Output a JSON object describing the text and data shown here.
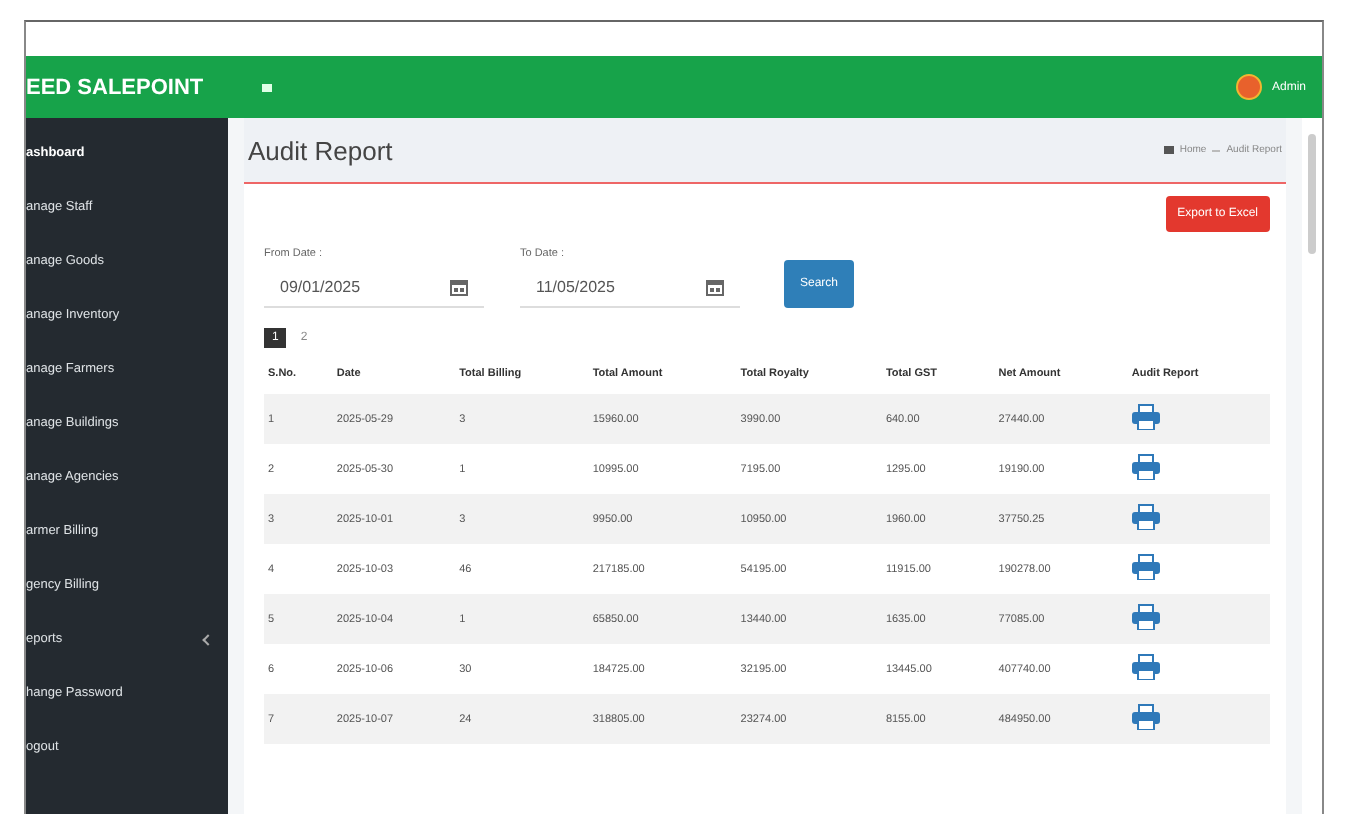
{
  "brand": "EED SALEPOINT",
  "user": {
    "name": "Admin"
  },
  "sidebar": {
    "items": [
      {
        "label": "ashboard",
        "selected": true,
        "has_submenu": false
      },
      {
        "label": "anage Staff",
        "selected": false,
        "has_submenu": false
      },
      {
        "label": "anage Goods",
        "selected": false,
        "has_submenu": false
      },
      {
        "label": "anage Inventory",
        "selected": false,
        "has_submenu": false
      },
      {
        "label": "anage Farmers",
        "selected": false,
        "has_submenu": false
      },
      {
        "label": "anage Buildings",
        "selected": false,
        "has_submenu": false
      },
      {
        "label": "anage Agencies",
        "selected": false,
        "has_submenu": false
      },
      {
        "label": "armer Billing",
        "selected": false,
        "has_submenu": false
      },
      {
        "label": "gency Billing",
        "selected": false,
        "has_submenu": false
      },
      {
        "label": "eports",
        "selected": false,
        "has_submenu": true
      },
      {
        "label": "hange Password",
        "selected": false,
        "has_submenu": false
      },
      {
        "label": "ogout",
        "selected": false,
        "has_submenu": false
      }
    ]
  },
  "page_title": "Audit Report",
  "breadcrumb": [
    "Home",
    "Audit Report"
  ],
  "export_button": "Export to Excel",
  "filters": [
    {
      "label": "From Date :",
      "value": "09/01/2025"
    },
    {
      "label": "To Date :",
      "value": "11/05/2025"
    }
  ],
  "search_button": "Search",
  "pagination": [
    {
      "label": "1",
      "selected": true
    },
    {
      "label": "2",
      "selected": false
    }
  ],
  "table": {
    "columns": [
      "S.No.",
      "Date",
      "Total Billing",
      "Total Amount",
      "Total Royalty",
      "Total GST",
      "Net Amount",
      "Audit Report"
    ],
    "rows": [
      [
        "1",
        "2025-05-29",
        "3",
        "15960.00",
        "3990.00",
        "640.00",
        "27440.00"
      ],
      [
        "2",
        "2025-05-30",
        "1",
        "10995.00",
        "7195.00",
        "1295.00",
        "19190.00"
      ],
      [
        "3",
        "2025-10-01",
        "3",
        "9950.00",
        "10950.00",
        "1960.00",
        "37750.25"
      ],
      [
        "4",
        "2025-10-03",
        "46",
        "217185.00",
        "54195.00",
        "11915.00",
        "190278.00"
      ],
      [
        "5",
        "2025-10-04",
        "1",
        "65850.00",
        "13440.00",
        "1635.00",
        "77085.00"
      ],
      [
        "6",
        "2025-10-06",
        "30",
        "184725.00",
        "32195.00",
        "13445.00",
        "407740.00"
      ],
      [
        "7",
        "2025-10-07",
        "24",
        "318805.00",
        "23274.00",
        "8155.00",
        "484950.00"
      ]
    ]
  }
}
